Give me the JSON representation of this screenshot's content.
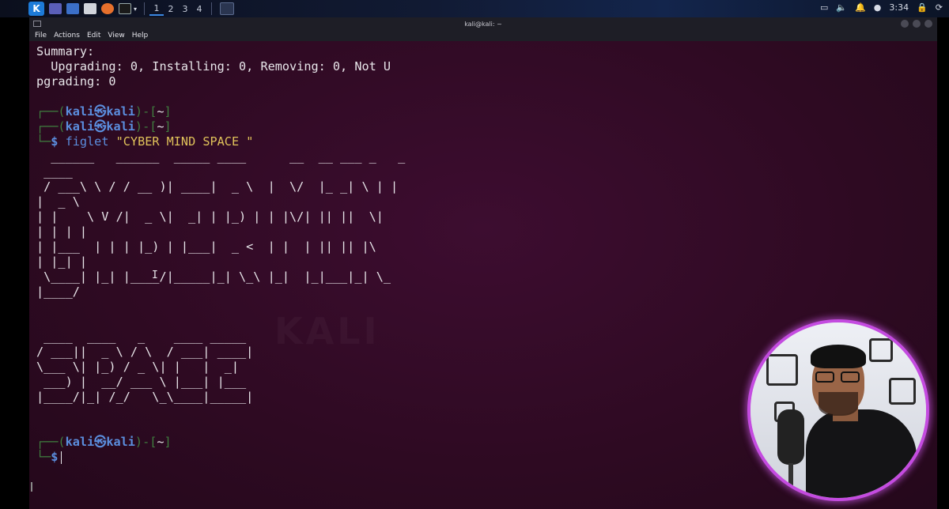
{
  "panel": {
    "workspaces": [
      "1",
      "2",
      "3",
      "4"
    ],
    "clock": "3:34"
  },
  "window": {
    "title": "kali@kali: ~",
    "menu": [
      "File",
      "Actions",
      "Edit",
      "View",
      "Help"
    ]
  },
  "terminal": {
    "watermark": "KALI",
    "lines": [
      {
        "kind": "plain",
        "text": "Summary:"
      },
      {
        "kind": "plain",
        "text": "  Upgrading: 0, Installing: 0, Removing: 0, Not U"
      },
      {
        "kind": "plain",
        "text": "pgrading: 0"
      },
      {
        "kind": "blank",
        "text": ""
      },
      {
        "kind": "prompt1",
        "text": ""
      },
      {
        "kind": "prompt1",
        "text": ""
      },
      {
        "kind": "command",
        "cmd": "figlet",
        "arg": "\"CYBER MIND SPACE \""
      },
      {
        "kind": "plain",
        "text": "  ______   ______  _____ ____      __  __ ___ _   _ "
      },
      {
        "kind": "plain",
        "text": " ____"
      },
      {
        "kind": "plain",
        "text": " / ___\\ \\ / / __ )| ____|  _ \\  |  \\/  |_ _| \\ | |"
      },
      {
        "kind": "plain",
        "text": "|  _ \\"
      },
      {
        "kind": "plain",
        "text": "| |    \\ V /|  _ \\|  _| | |_) | | |\\/| || ||  \\|"
      },
      {
        "kind": "plain",
        "text": "| | | |"
      },
      {
        "kind": "plain",
        "text": "| |___  | | | |_) | |___|  _ <  | |  | || || |\\ "
      },
      {
        "kind": "plain",
        "text": "| |_| |"
      },
      {
        "kind": "plain",
        "text": " \\____| |_| |____/|_____|_| \\_\\ |_|  |_|___|_| \\_"
      },
      {
        "kind": "plain",
        "text": "|____/"
      },
      {
        "kind": "blank",
        "text": ""
      },
      {
        "kind": "blank",
        "text": ""
      },
      {
        "kind": "plain",
        "text": " ____  ____   _    ____ _____"
      },
      {
        "kind": "plain",
        "text": "/ ___||  _ \\ / \\  / ___| ____|"
      },
      {
        "kind": "plain",
        "text": "\\___ \\| |_) / _ \\| |   |  _|"
      },
      {
        "kind": "plain",
        "text": " ___) |  __/ ___ \\ |___| |___"
      },
      {
        "kind": "plain",
        "text": "|____/|_| /_/   \\_\\____|_____|"
      },
      {
        "kind": "blank",
        "text": ""
      },
      {
        "kind": "blank",
        "text": ""
      },
      {
        "kind": "prompt1",
        "text": ""
      },
      {
        "kind": "prompt2",
        "text": ""
      }
    ],
    "prompt": {
      "open": "┌──(",
      "user": "kali",
      "at": "㉿",
      "host": "kali",
      "mid": ")-[",
      "path": "~",
      "close": "]",
      "second": "└─",
      "dollar": "$"
    }
  },
  "colors": {
    "terminal_bg": "#300a24",
    "prompt_user": "#5b8ede",
    "prompt_bracket": "#3f7f3f",
    "command_arg": "#e0c25a",
    "webcam_ring": "#c44be0"
  }
}
